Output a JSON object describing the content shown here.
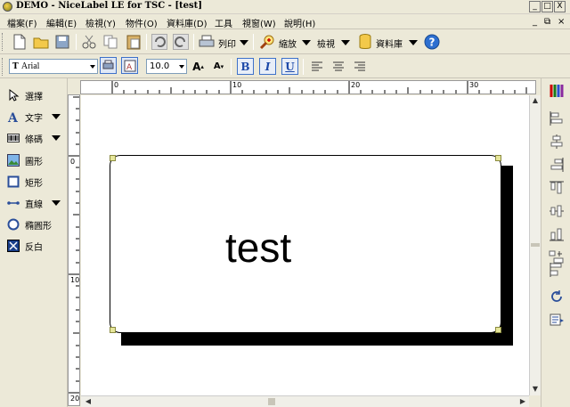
{
  "window": {
    "title": "DEMO - NiceLabel LE for TSC - [test]",
    "controls": {
      "minimize": "_",
      "maximize": "□",
      "close": "X"
    }
  },
  "menu": {
    "items": [
      "檔案(F)",
      "編輯(E)",
      "檢視(Y)",
      "物件(O)",
      "資料庫(D)",
      "工具",
      "視窗(W)",
      "說明(H)"
    ],
    "mdi_controls": {
      "minimize": "_",
      "restore": "⧉",
      "close": "×"
    }
  },
  "toolbar": {
    "print_label": "列印",
    "zoom_label": "縮放",
    "view_label": "檢視",
    "database_label": "資料庫"
  },
  "format": {
    "font_name": "Arial",
    "font_size": "10.0",
    "increase_font": "A",
    "decrease_font": "A",
    "bold": "B",
    "italic": "I",
    "underline": "U"
  },
  "tools": {
    "select": "選擇",
    "text": "文字",
    "barcode": "條碼",
    "graphic": "圖形",
    "rectangle": "矩形",
    "line": "直線",
    "ellipse": "橢圓形",
    "inverse": "反白"
  },
  "ruler": {
    "h_ticks": [
      "0",
      "10",
      "20",
      "30"
    ],
    "v_ticks": [
      "0",
      "10",
      "20"
    ]
  },
  "label": {
    "text": "test"
  }
}
